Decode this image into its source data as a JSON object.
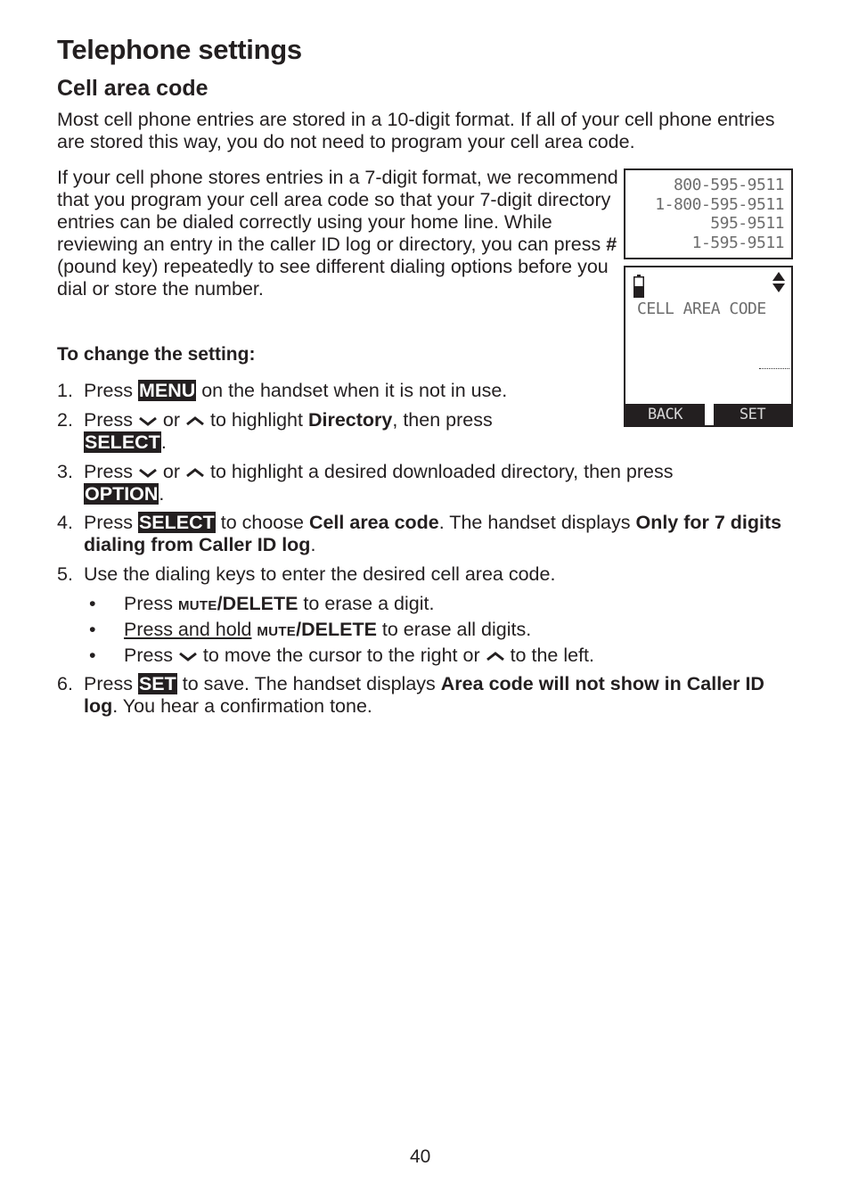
{
  "header": {
    "title": "Telephone settings",
    "subtitle": "Cell area code"
  },
  "intro": {
    "p1": "Most cell phone entries are stored in a 10-digit format. If all of your cell phone entries are stored this way, you do not need to program your cell area code.",
    "p2_before": "If your cell phone stores entries in a 7-digit format, we recommend that you program your cell area code so that your 7-digit directory entries can be dialed correctly using your home line. While reviewing an entry in the caller ID log or directory, you can press ",
    "p2_key": "#",
    "p2_after": " (pound key) repeatedly to see different dialing options before you dial or store the number."
  },
  "instructions": {
    "heading": "To change the setting:",
    "steps": [
      {
        "num": "1.",
        "t1": "Press ",
        "key": "MENU",
        "t2": " on the handset when it is not in use."
      },
      {
        "num": "2.",
        "t1": "Press ",
        "or": " or ",
        "t2": " to highlight ",
        "bold": "Directory",
        "t3": ", then press ",
        "key": "SELECT",
        "t4": "."
      },
      {
        "num": "3.",
        "t1": "Press ",
        "or": " or ",
        "t2": " to highlight a desired downloaded directory, then press ",
        "key": "OPTION",
        "t3": "."
      },
      {
        "num": "4.",
        "t1": "Press ",
        "key": "SELECT",
        "t2": " to choose ",
        "bold1": "Cell area code",
        "t3": ". The handset displays ",
        "bold2": "Only for 7 digits dialing from Caller ID log",
        "t4": "."
      },
      {
        "num": "5.",
        "t1": "Use the dialing keys to enter the desired cell area code."
      },
      {
        "num": "6.",
        "t1": "Press ",
        "key": "SET",
        "t2": " to save. The handset displays ",
        "bold": "Area code will not show in Caller ID log",
        "t3": ". You hear a confirmation tone."
      }
    ],
    "bullets": [
      {
        "dot": "•",
        "t1": "Press ",
        "sc": "MUTE",
        "bold": "/DELETE",
        "t2": " to erase a digit."
      },
      {
        "dot": "•",
        "u": "Press and hold",
        "sp": " ",
        "sc": "MUTE",
        "bold": "/DELETE",
        "t2": " to erase all digits."
      },
      {
        "dot": "•",
        "t1": "Press ",
        "t2": " to move the cursor to the right or ",
        "t3": " to the left."
      }
    ]
  },
  "display_numbers": {
    "lines": [
      "800-595-9511",
      "1-800-595-9511",
      "595-9511",
      "1-595-9511"
    ]
  },
  "display_setting": {
    "title": "CELL AREA CODE",
    "softkey_left": "BACK",
    "softkey_right": "SET",
    "icons": [
      "battery-icon",
      "scroll-arrows-icon"
    ]
  },
  "footer": {
    "page_number": "40"
  }
}
